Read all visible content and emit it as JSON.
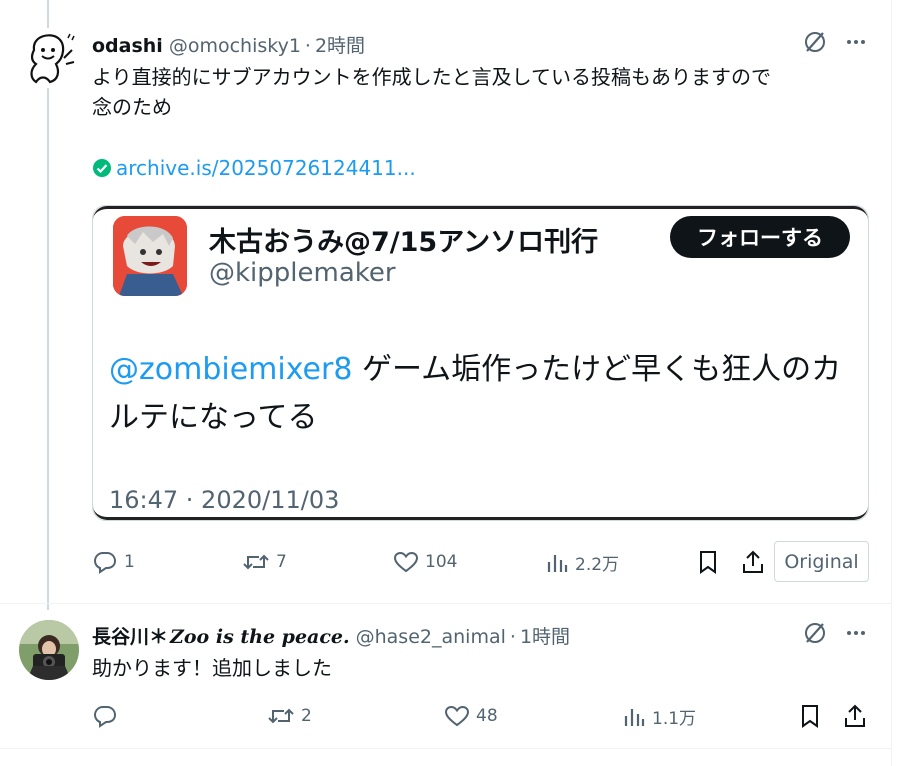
{
  "posts": [
    {
      "display_name": "odashi",
      "handle": "@omochisky1",
      "separator": "·",
      "time": "2時間",
      "text_line1": "より直接的にサブアカウントを作成したと言及している投稿もありますので",
      "text_line2": "念のため",
      "link_text": "archive.is/20250726124411...",
      "embed": {
        "name": "木古おうみ@7/15アンソロ刊行",
        "handle": "@kipplemaker",
        "follow_label": "フォローする",
        "mention": "@zombiemixer8",
        "text": " ゲーム垢作ったけど早くも狂人のカルテになってる",
        "timestamp": "16:47 · 2020/11/03"
      },
      "actions": {
        "replies": "1",
        "reposts": "7",
        "likes": "104",
        "views": "2.2万"
      },
      "original_label": "Original"
    },
    {
      "display_name_jp": "長谷川＊",
      "display_name_en": "Zoo is the peace.",
      "handle": "@hase2_animal",
      "separator": "·",
      "time": "1時間",
      "text_line1": "助かります！追加しました",
      "actions": {
        "replies": "",
        "reposts": "2",
        "likes": "48",
        "views": "1.1万"
      }
    }
  ],
  "colors": {
    "link": "#1d9bf0",
    "muted": "#536471",
    "text": "#0f1419",
    "verified": "#00ba7c"
  }
}
